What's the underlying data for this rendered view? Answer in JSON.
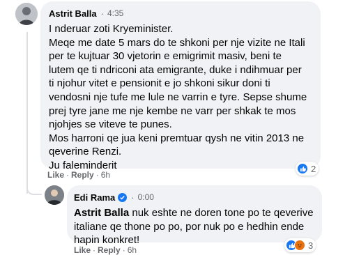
{
  "comment": {
    "author": "Astrit Balla",
    "time": "4:35",
    "lines": [
      "I nderuar zoti Kryeminister.",
      "Meqe me date 5 mars do te shkoni per nje vizite ne Itali",
      "per te kujtuar 30 vjetorin e emigrimit masiv, beni te",
      "lutem qe ti ndriconi ata emigrante, duke i ndihmuar per",
      "ti njohur vitet e pensionit e jo shkoni sikur doni ti",
      "vendosni nje tufe me lule ne varrin e tyre. Sepse shume",
      "prej tyre jane me nje kembe ne varr per shkak te mos",
      "njohjes se viteve te punes.",
      "Mos harroni qe jua keni premtuar qysh ne vitin 2013 ne",
      "qeverine Renzi.",
      "Ju faleminderit"
    ],
    "actions": {
      "like": "Like",
      "separator": "·",
      "reply": "Reply",
      "age": "6h"
    },
    "reactions": {
      "icons": [
        "like-icon"
      ],
      "count": "2"
    }
  },
  "reply": {
    "author": "Edi Rama",
    "verified": true,
    "time": "0:00",
    "mention": "Astrit Balla",
    "lines": [
      " nuk eshte ne doren tone po te qeverive",
      "italiane qe thone po po, por nuk po e hedhin ende",
      "hapin konkret!"
    ],
    "actions": {
      "like": "Like",
      "separator": "·",
      "reply": "Reply",
      "age": "6h"
    },
    "reactions": {
      "icons": [
        "like-icon",
        "angry-icon"
      ],
      "count": "3"
    }
  },
  "colors": {
    "bubble": "#f0f2f5",
    "meta_text": "#65676b",
    "like_blue": "#1877f2",
    "angry_orange": "#e9710f"
  }
}
